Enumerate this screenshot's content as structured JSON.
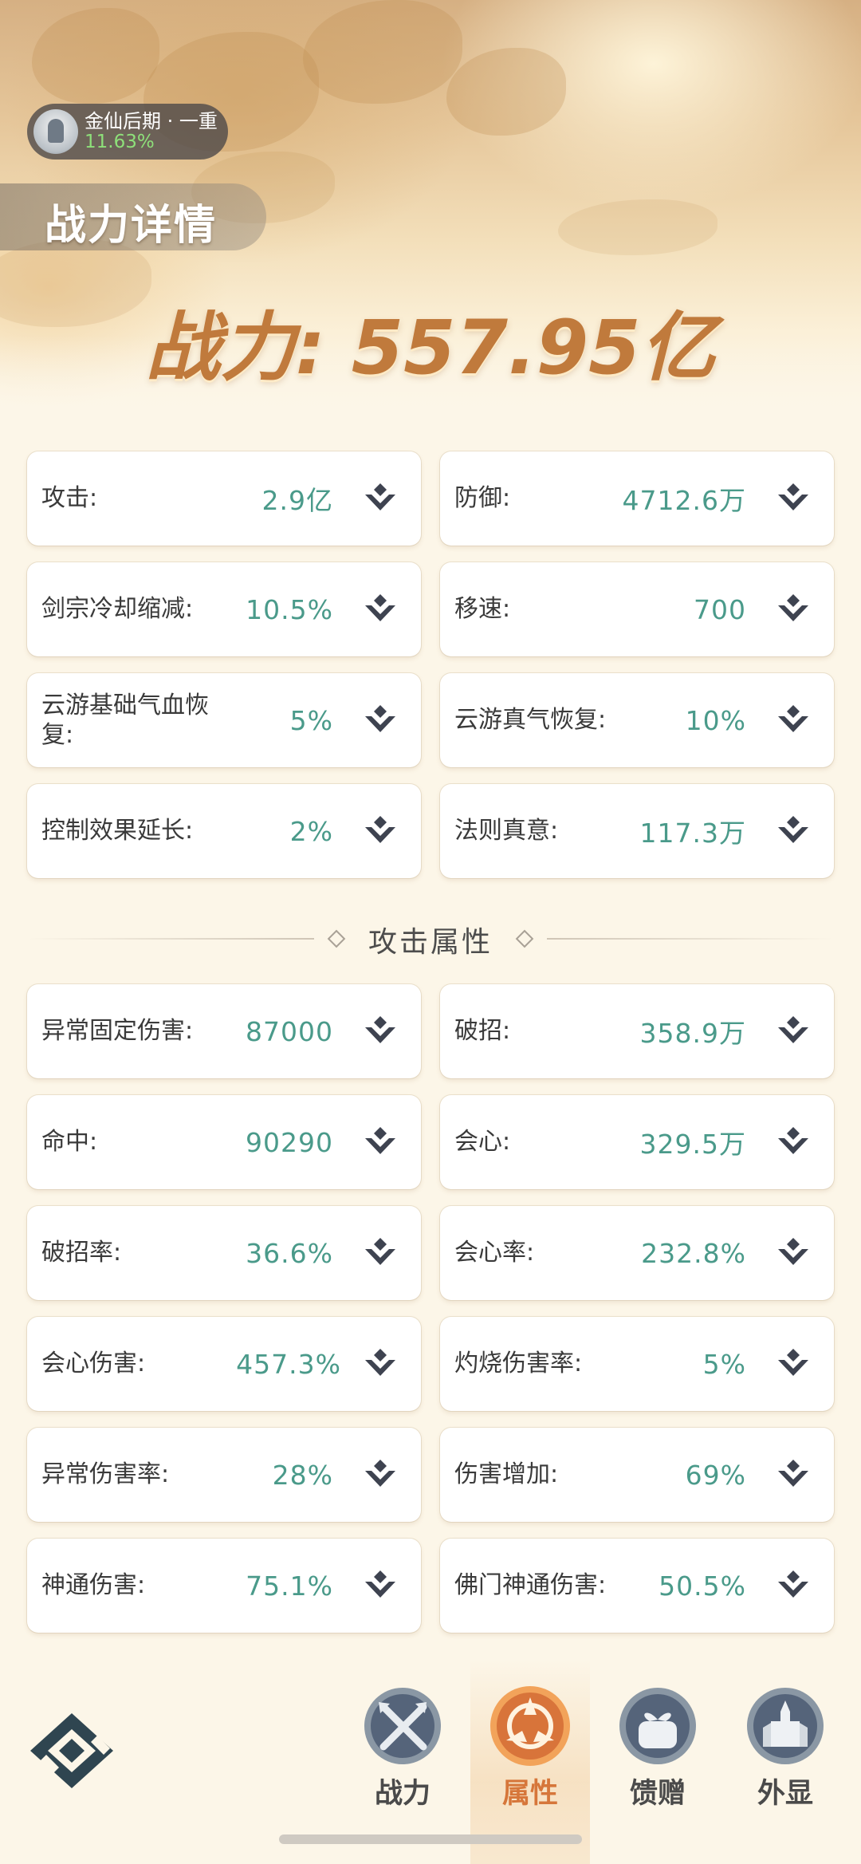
{
  "header": {
    "realm_name": "金仙后期 · 一重",
    "realm_progress": "11.63%",
    "page_title": "战力详情",
    "power_label": "战力:",
    "power_value": "557.95亿"
  },
  "base_stats": [
    {
      "label": "攻击:",
      "value": "2.9亿"
    },
    {
      "label": "防御:",
      "value": "4712.6万"
    },
    {
      "label": "剑宗冷却缩减:",
      "value": "10.5%"
    },
    {
      "label": "移速:",
      "value": "700"
    },
    {
      "label": "云游基础气血恢复:",
      "value": "5%"
    },
    {
      "label": "云游真气恢复:",
      "value": "10%"
    },
    {
      "label": "控制效果延长:",
      "value": "2%"
    },
    {
      "label": "法则真意:",
      "value": "117.3万"
    }
  ],
  "attack_section": {
    "title": "攻击属性",
    "stats": [
      {
        "label": "异常固定伤害:",
        "value": "87000"
      },
      {
        "label": "破招:",
        "value": "358.9万"
      },
      {
        "label": "命中:",
        "value": "90290"
      },
      {
        "label": "会心:",
        "value": "329.5万"
      },
      {
        "label": "破招率:",
        "value": "36.6%"
      },
      {
        "label": "会心率:",
        "value": "232.8%"
      },
      {
        "label": "会心伤害:",
        "value": "457.3%"
      },
      {
        "label": "灼烧伤害率:",
        "value": "5%"
      },
      {
        "label": "异常伤害率:",
        "value": "28%"
      },
      {
        "label": "伤害增加:",
        "value": "69%"
      },
      {
        "label": "神通伤害:",
        "value": "75.1%"
      },
      {
        "label": "佛门神通伤害:",
        "value": "50.5%"
      }
    ]
  },
  "bottom_nav": {
    "tabs": [
      {
        "label": "战力",
        "icon": "crossed-swords-icon",
        "active": false
      },
      {
        "label": "属性",
        "icon": "triskelion-emblem-icon",
        "active": true
      },
      {
        "label": "馈赠",
        "icon": "gift-box-icon",
        "active": false
      },
      {
        "label": "外显",
        "icon": "castle-icon",
        "active": false
      }
    ]
  },
  "colors": {
    "value_teal": "#4a9a8a",
    "power_orange": "#c07a3c",
    "active_tab": "#d6763a",
    "card_bg": "#ffffff",
    "page_bg": "#fcf6e8"
  }
}
